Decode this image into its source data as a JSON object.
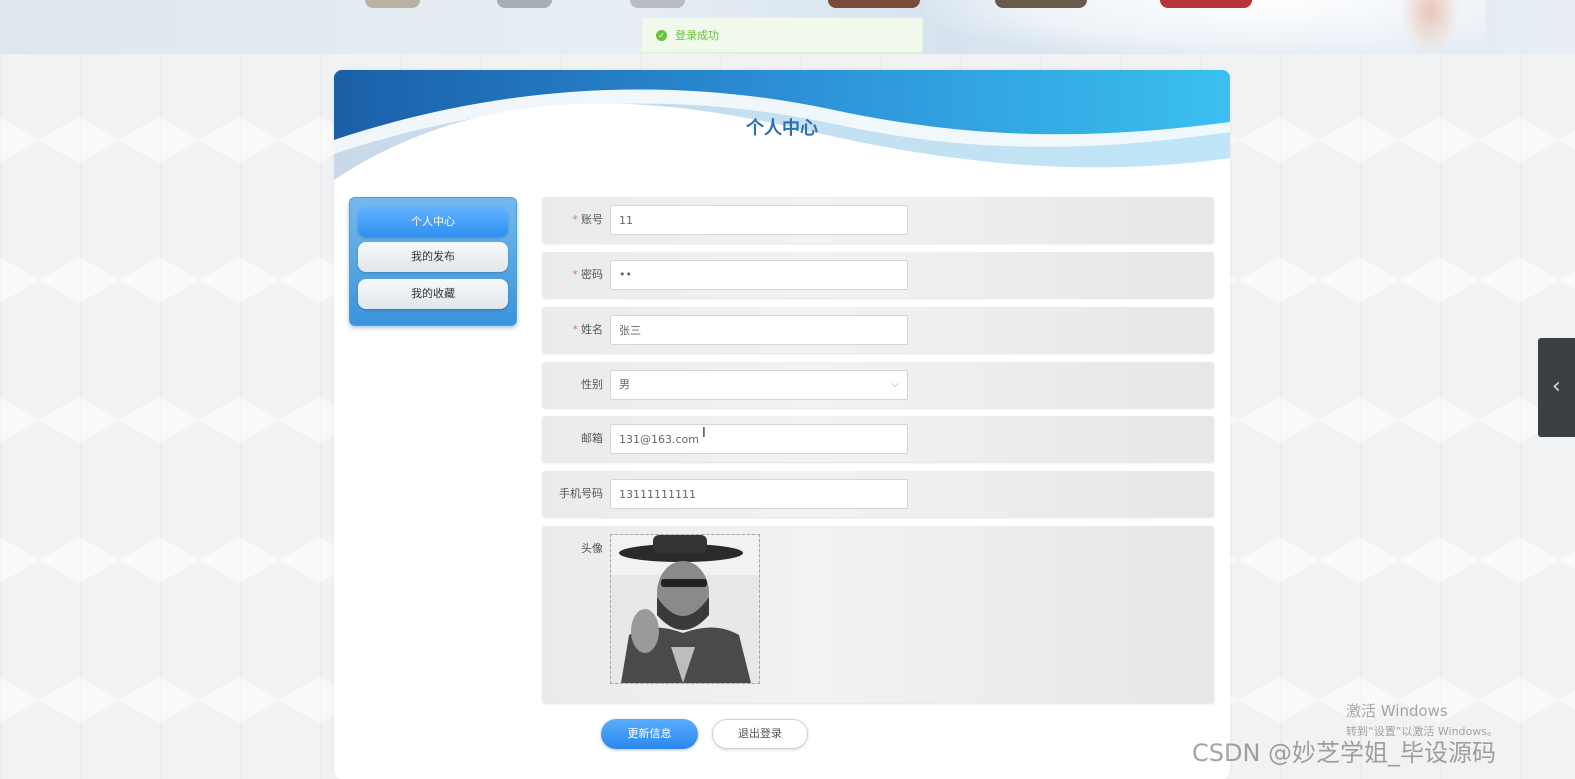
{
  "toast": {
    "message": "登录成功",
    "icon": "success-check-icon",
    "color": "#67c23a"
  },
  "page": {
    "title": "个人中心"
  },
  "sidebar": {
    "items": [
      {
        "label": "个人中心",
        "active": true
      },
      {
        "label": "我的发布",
        "active": false
      },
      {
        "label": "我的收藏",
        "active": false
      }
    ]
  },
  "form": {
    "account": {
      "label": "账号",
      "required": true,
      "value": "11"
    },
    "password": {
      "label": "密码",
      "required": true,
      "value": "••"
    },
    "name": {
      "label": "姓名",
      "required": true,
      "value": "张三"
    },
    "gender": {
      "label": "性别",
      "required": false,
      "value": "男"
    },
    "email": {
      "label": "邮箱",
      "required": false,
      "value": "131@163.com"
    },
    "phone": {
      "label": "手机号码",
      "required": false,
      "value": "13111111111"
    },
    "avatar": {
      "label": "头像"
    }
  },
  "actions": {
    "update": "更新信息",
    "logout": "退出登录"
  },
  "watermarks": {
    "windows_title": "激活 Windows",
    "windows_sub": "转到“设置”以激活 Windows。",
    "csdn": "CSDN @妙芝学姐_毕设源码"
  },
  "colors": {
    "accent": "#2f8ff0",
    "title": "#2a6fb0",
    "required": "#f56c6c"
  }
}
